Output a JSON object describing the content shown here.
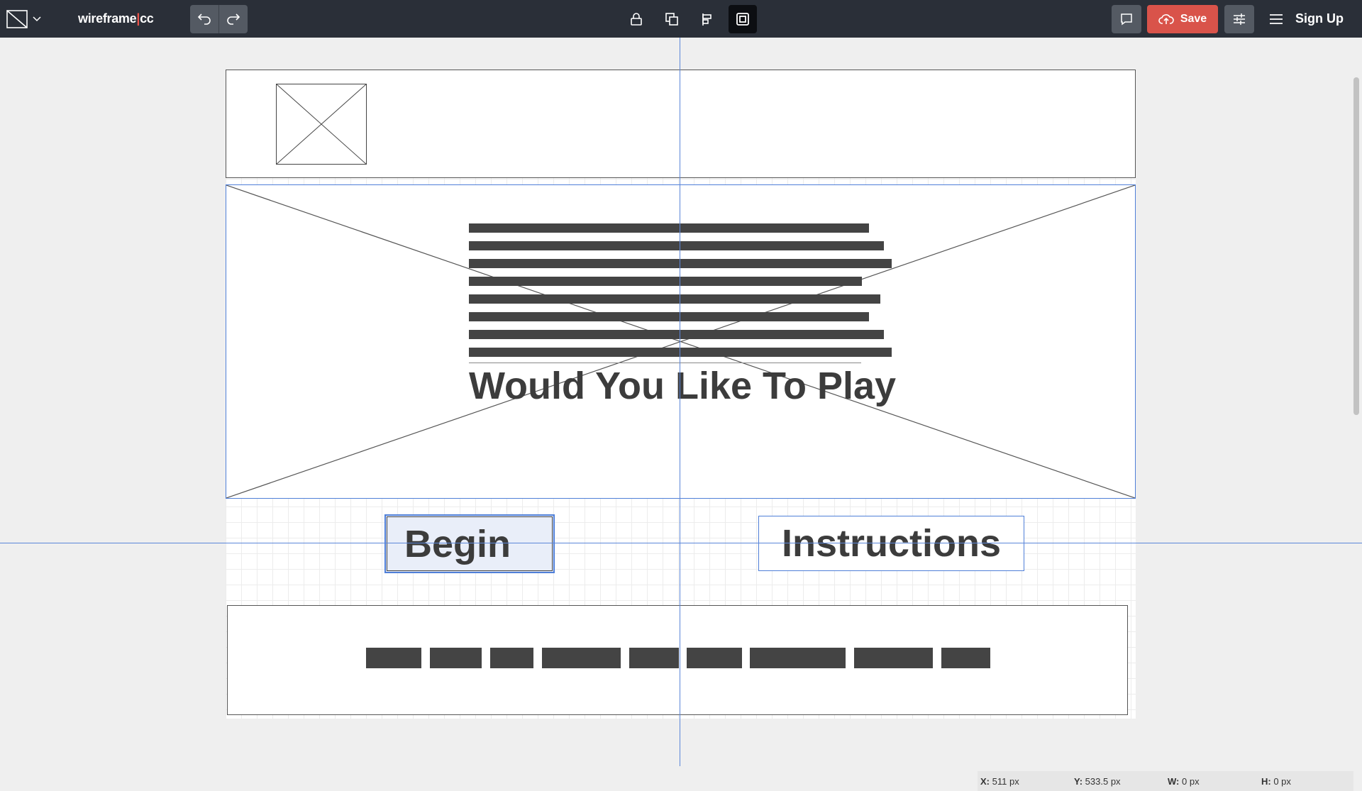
{
  "app": {
    "brand_left": "wireframe",
    "brand_sep": "|",
    "brand_right": "cc"
  },
  "toolbar": {
    "save_label": "Save",
    "signup_label": "Sign Up",
    "icons": [
      "shape-icon",
      "chevron-down-icon",
      "undo-icon",
      "redo-icon",
      "lock-icon",
      "duplicate-icon",
      "align-icon",
      "frame-icon",
      "comment-icon",
      "cloud-upload-icon",
      "sliders-icon",
      "menu-icon"
    ],
    "active_tool": "frame-icon"
  },
  "canvas": {
    "hero_title": "Would You Like To Play",
    "begin_label": "Begin",
    "instructions_label": "Instructions"
  },
  "status": {
    "x_label": "X:",
    "x_value": "511 px",
    "y_label": "Y:",
    "y_value": "533.5 px",
    "w_label": "W:",
    "w_value": "0 px",
    "h_label": "H:",
    "h_value": "0 px"
  },
  "colors": {
    "toolbar_bg": "#2a2f38",
    "save_accent": "#d9534a",
    "guide_blue": "#5b86d9",
    "placeholder_text": "#444444"
  }
}
